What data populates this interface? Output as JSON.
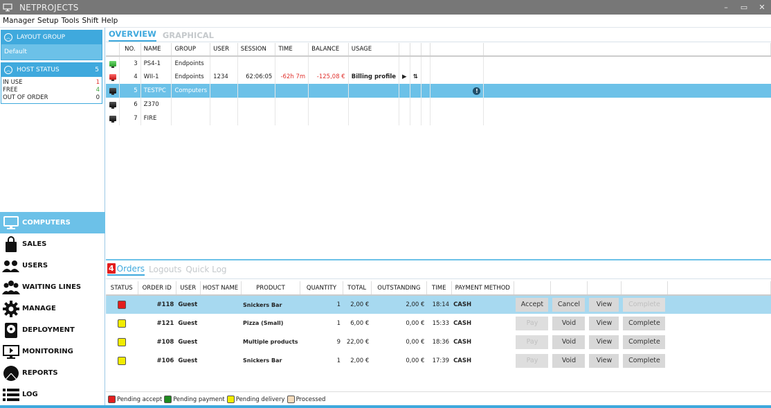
{
  "window": {
    "title": "NETPROJECTS",
    "controls": {
      "minimize": "–",
      "maximize": "▭",
      "close": "✕"
    }
  },
  "menu": [
    "Manager",
    "Setup",
    "Tools",
    "Shift",
    "Help"
  ],
  "sidebar": {
    "layout_group": {
      "title": "LAYOUT GROUP",
      "value": "Default"
    },
    "host_status": {
      "title": "HOST STATUS",
      "total": "5",
      "rows": [
        {
          "label": "IN USE",
          "value": "1",
          "color": "#e0312d"
        },
        {
          "label": "FREE",
          "value": "4",
          "color": "#3aa23a"
        },
        {
          "label": "OUT OF ORDER",
          "value": "0",
          "color": "#222222"
        }
      ]
    },
    "nav": [
      {
        "label": "COMPUTERS",
        "icon": "monitor-icon",
        "active": true
      },
      {
        "label": "SALES",
        "icon": "shopping-bag-icon",
        "active": false
      },
      {
        "label": "USERS",
        "icon": "users-icon",
        "active": false
      },
      {
        "label": "WAITING LINES",
        "icon": "group-icon",
        "active": false
      },
      {
        "label": "MANAGE",
        "icon": "gear-icon",
        "active": false
      },
      {
        "label": "DEPLOYMENT",
        "icon": "hard-drive-icon",
        "active": false
      },
      {
        "label": "MONITORING",
        "icon": "monitor-play-icon",
        "active": false
      },
      {
        "label": "REPORTS",
        "icon": "pie-chart-icon",
        "active": false
      },
      {
        "label": "LOG",
        "icon": "list-icon",
        "active": false
      }
    ]
  },
  "main": {
    "tabs": [
      {
        "label": "OVERVIEW",
        "active": true
      },
      {
        "label": "GRAPHICAL",
        "active": false
      }
    ],
    "hosts_table": {
      "columns": [
        "",
        "NO.",
        "NAME",
        "GROUP",
        "USER",
        "SESSION",
        "TIME",
        "BALANCE",
        "USAGE",
        "",
        "",
        "",
        "",
        ""
      ],
      "rows": [
        {
          "state": "green",
          "no": "3",
          "name": "PS4-1",
          "group": "Endpoints",
          "user": "",
          "session": "",
          "time": "",
          "balance": "",
          "usage": "",
          "selected": false,
          "play": false,
          "transfer": false,
          "alert": false
        },
        {
          "state": "red",
          "no": "4",
          "name": "WII-1",
          "group": "Endpoints",
          "user": "1234",
          "session": "62:06:05",
          "time": "-62h 7m",
          "balance": "-125,08 €",
          "usage": "Billing profile",
          "selected": false,
          "play": true,
          "transfer": true,
          "alert": false
        },
        {
          "state": "black",
          "no": "5",
          "name": "TESTPC",
          "group": "Computers",
          "user": "",
          "session": "",
          "time": "",
          "balance": "",
          "usage": "",
          "selected": true,
          "play": false,
          "transfer": false,
          "alert": true
        },
        {
          "state": "black",
          "no": "6",
          "name": "Z370",
          "group": "",
          "user": "",
          "session": "",
          "time": "",
          "balance": "",
          "usage": "",
          "selected": false,
          "play": false,
          "transfer": false,
          "alert": false
        },
        {
          "state": "black",
          "no": "7",
          "name": "FIRE",
          "group": "",
          "user": "",
          "session": "",
          "time": "",
          "balance": "",
          "usage": "",
          "selected": false,
          "play": false,
          "transfer": false,
          "alert": false
        }
      ]
    },
    "orders": {
      "badge": "4",
      "tabs": [
        {
          "label": "Orders",
          "active": true
        },
        {
          "label": "Logouts",
          "active": false
        },
        {
          "label": "Quick Log",
          "active": false
        }
      ],
      "columns": [
        "STATUS",
        "ORDER ID",
        "USER",
        "HOST NAME",
        "PRODUCT",
        "QUANTITY",
        "TOTAL",
        "OUTSTANDING",
        "TIME",
        "PAYMENT METHOD",
        "",
        "",
        "",
        "",
        ""
      ],
      "rows": [
        {
          "status_color": "#e31d1d",
          "order_id": "#118",
          "user": "Guest",
          "host": "",
          "product": "Snickers Bar",
          "quantity": "1",
          "total": "2,00 €",
          "outstanding": "2,00 €",
          "time": "18:14",
          "payment": "CASH",
          "selected": true,
          "buttons": [
            {
              "label": "Accept",
              "enabled": true
            },
            {
              "label": "Cancel",
              "enabled": true
            },
            {
              "label": "View",
              "enabled": true
            },
            {
              "label": "Complete",
              "enabled": false
            }
          ]
        },
        {
          "status_color": "#f2ec00",
          "order_id": "#121",
          "user": "Guest",
          "host": "",
          "product": "Pizza (Small)",
          "quantity": "1",
          "total": "6,00 €",
          "outstanding": "0,00 €",
          "time": "15:33",
          "payment": "CASH",
          "selected": false,
          "buttons": [
            {
              "label": "Pay",
              "enabled": false
            },
            {
              "label": "Void",
              "enabled": true
            },
            {
              "label": "View",
              "enabled": true
            },
            {
              "label": "Complete",
              "enabled": true
            }
          ]
        },
        {
          "status_color": "#f2ec00",
          "order_id": "#108",
          "user": "Guest",
          "host": "",
          "product": "Multiple products",
          "quantity": "9",
          "total": "22,00 €",
          "outstanding": "0,00 €",
          "time": "18:36",
          "payment": "CASH",
          "selected": false,
          "buttons": [
            {
              "label": "Pay",
              "enabled": false
            },
            {
              "label": "Void",
              "enabled": true
            },
            {
              "label": "View",
              "enabled": true
            },
            {
              "label": "Complete",
              "enabled": true
            }
          ]
        },
        {
          "status_color": "#f2ec00",
          "order_id": "#106",
          "user": "Guest",
          "host": "",
          "product": "Snickers Bar",
          "quantity": "1",
          "total": "2,00 €",
          "outstanding": "0,00 €",
          "time": "17:39",
          "payment": "CASH",
          "selected": false,
          "buttons": [
            {
              "label": "Pay",
              "enabled": false
            },
            {
              "label": "Void",
              "enabled": true
            },
            {
              "label": "View",
              "enabled": true
            },
            {
              "label": "Complete",
              "enabled": true
            }
          ]
        }
      ],
      "legend": [
        {
          "label": "Pending accept",
          "color": "#e31d1d"
        },
        {
          "label": "Pending payment",
          "color": "#1f8a1f"
        },
        {
          "label": "Pending delivery",
          "color": "#f2ec00"
        },
        {
          "label": "Processed",
          "color": "#f6dcbc"
        }
      ]
    }
  },
  "colors": {
    "accent": "#3fa9dd",
    "selected_row": "#6cc1e8",
    "selected_order_row": "#a7d9f0",
    "title_bar": "#777777"
  }
}
